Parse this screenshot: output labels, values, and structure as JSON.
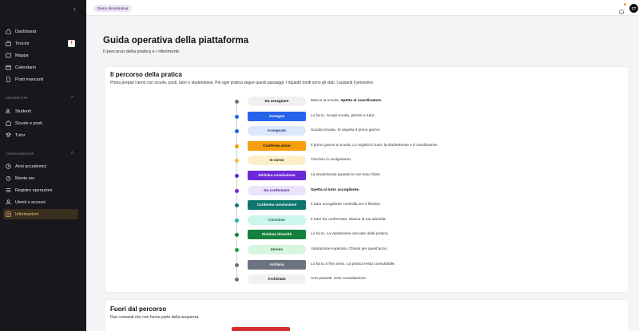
{
  "sidebar": {
    "items_top": [
      {
        "label": "Dashboard",
        "icon": "home-icon"
      },
      {
        "label": "Tirocini",
        "icon": "briefcase-icon",
        "badge": "T"
      },
      {
        "label": "Mappa",
        "icon": "map-icon"
      },
      {
        "label": "Calendario",
        "icon": "calendar-icon"
      },
      {
        "label": "Posti mancanti",
        "icon": "document-icon"
      }
    ],
    "section_anagrafiche": "ANAGRAFICHE",
    "items_anagrafiche": [
      {
        "label": "Studenti",
        "icon": "users-icon"
      },
      {
        "label": "Scuole e posti",
        "icon": "school-icon"
      },
      {
        "label": "Tutor",
        "icon": "tutor-icon"
      }
    ],
    "section_configurazione": "CONFIGURAZIONE",
    "items_config": [
      {
        "label": "Anni accademici",
        "icon": "clock-icon"
      },
      {
        "label": "Monte ore",
        "icon": "timer-icon"
      },
      {
        "label": "Registro operazioni",
        "icon": "list-icon"
      },
      {
        "label": "Utenti e accessi",
        "icon": "user-lock-icon"
      },
      {
        "label": "Informazioni",
        "icon": "info-icon",
        "active": true
      }
    ]
  },
  "topbar": {
    "demo": "Demo dimostrativa",
    "avatar": "CT"
  },
  "header": {
    "title": "Guida operativa della piattaforma",
    "subtitle": "Il percorso della pratica e i riferimenti."
  },
  "percorso": {
    "title": "Il percorso della pratica",
    "desc": "Prima prepari l'anno con scuole, posti, tutor e studentesse. Poi ogni pratica segue questi passaggi. I riquadri tondi sono gli stati. I pulsanti il prossimo.",
    "steps": [
      {
        "label": "Da assegnare",
        "text": "Manca la scuola. ",
        "bold": "Spetta al coordinatore.",
        "pill_bg": "#f1f1f3",
        "pill_fg": "#111111",
        "dot": "#6b7280"
      },
      {
        "label": "Assegna",
        "text": "Lo fai tu. Scegli scuola, plesso e tutor.",
        "bold": "",
        "pill_bg": "#2563eb",
        "pill_fg": "#ffffff",
        "dot": "#2563eb"
      },
      {
        "label": "Assegnato",
        "text": "Scuola trovata. Si aspetta il primo giorno.",
        "bold": "",
        "pill_bg": "#dbe7fb",
        "pill_fg": "#1e3a8a",
        "dot": "#2563eb"
      },
      {
        "label": "Conferma avvio",
        "text": "Il primo giorno a scuola. Lo registra il tutor, la studentessa o il coordinatore.",
        "bold": "",
        "pill_bg": "#f59e0b",
        "pill_fg": "#111111",
        "dot": "#f59e0b"
      },
      {
        "label": "In corso",
        "text": "Tirocinio in svolgimento.",
        "bold": "",
        "pill_bg": "#fdf0c8",
        "pill_fg": "#111111",
        "dot": "#f5b942"
      },
      {
        "label": "Dichiara conclusione",
        "text": "La studentessa quando le ore sono finite.",
        "bold": "",
        "pill_bg": "#6d28d9",
        "pill_fg": "#ffffff",
        "dot": "#6d28d9"
      },
      {
        "label": "Da confermare",
        "text": "",
        "bold": "Spetta al tutor accogliente.",
        "pill_bg": "#ebe3fa",
        "pill_fg": "#4c1d95",
        "dot": "#6d28d9"
      },
      {
        "label": "Conferma conclusione",
        "text": "Il tutor accogliente controlla ore e libretto.",
        "bold": "",
        "pill_bg": "#0f766e",
        "pill_fg": "#ffffff",
        "dot": "#0f766e"
      },
      {
        "label": "Concluso",
        "text": "Il tutor ha confermato. Manca la tua idoneità.",
        "bold": "",
        "pill_bg": "#ccf5ec",
        "pill_fg": "#115e59",
        "dot": "#14b8a6"
      },
      {
        "label": "Dichiara idoneità",
        "text": "Lo fai tu. La valutazione annuale della pratica.",
        "bold": "",
        "pill_bg": "#15803d",
        "pill_fg": "#ffffff",
        "dot": "#15803d"
      },
      {
        "label": "Idoneo",
        "text": "Valutazione superata. Chiusa per quest'anno.",
        "bold": "",
        "pill_bg": "#d8f5de",
        "pill_fg": "#14532d",
        "dot": "#16a34a"
      },
      {
        "label": "Archivia",
        "text": "Lo fai tu a fine anno. La pratica resta consultabile.",
        "bold": "",
        "pill_bg": "#6b7280",
        "pill_fg": "#ffffff",
        "dot": "#6b7280"
      },
      {
        "label": "Archiviato",
        "text": "Anni passati. Solo consultazione.",
        "bold": "",
        "pill_bg": "#f1f1f3",
        "pill_fg": "#111111",
        "dot": "#6b7280"
      }
    ]
  },
  "fuori": {
    "title": "Fuori dal percorso",
    "desc": "Due comandi che non fanno parte della sequenza."
  }
}
